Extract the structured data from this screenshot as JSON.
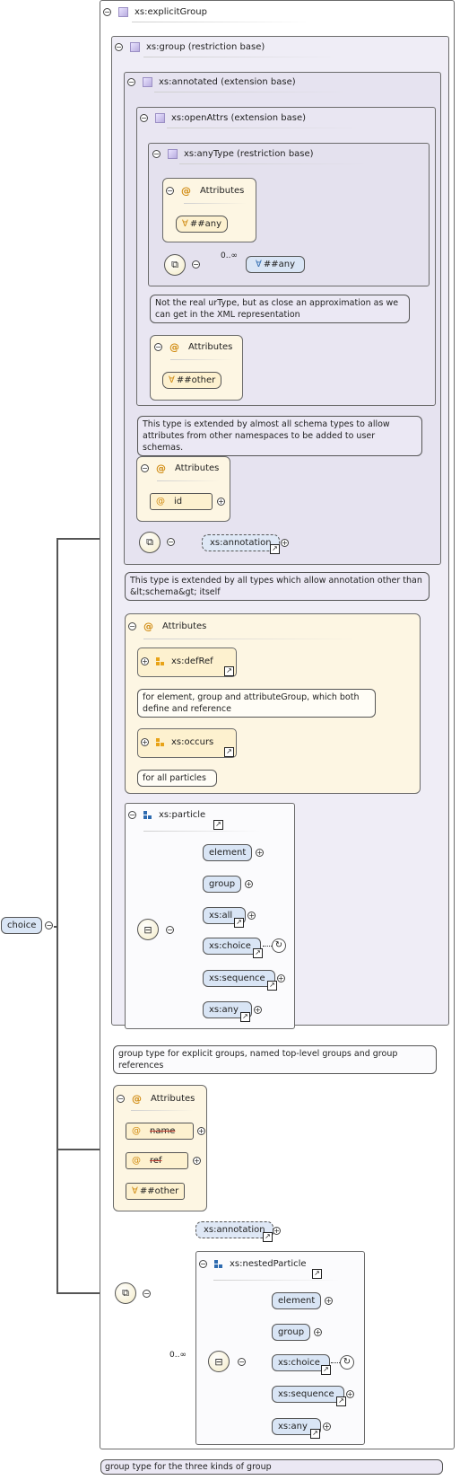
{
  "root": {
    "label": "choice"
  },
  "explicit_group": {
    "title": "xs:explicitGroup",
    "group_restriction": {
      "title": "xs:group (restriction base)",
      "annotated": {
        "title": "xs:annotated (extension base)",
        "open_attrs": {
          "title": "xs:openAttrs (extension base)",
          "any_type": {
            "title": "xs:anyType (restriction base)",
            "attributes_label": "Attributes",
            "any_attr": "##any",
            "any_element": "##any",
            "multiplicity": "0..∞"
          },
          "any_type_note": "Not the real urType, but as close an approximation as we can get in the XML representation",
          "attributes_label": "Attributes",
          "other_attr": "##other"
        },
        "open_attrs_note": "This type is extended by almost all schema types to allow attributes from other namespaces to be added to user schemas.",
        "attributes_label": "Attributes",
        "id_attr": "id",
        "annotation_element": "xs:annotation"
      },
      "annotated_note": "This type is extended by all types which allow annotation other than &lt;schema&gt; itself",
      "attributes": {
        "label": "Attributes",
        "def_ref": "xs:defRef",
        "def_ref_note": "for element, group and attributeGroup, which both define and reference",
        "occurs": "xs:occurs",
        "occurs_note": "for all particles"
      },
      "particle": {
        "title": "xs:particle",
        "items": [
          "element",
          "group",
          "xs:all",
          "xs:choice",
          "xs:sequence",
          "xs:any"
        ]
      }
    },
    "group_note": "group type for explicit groups, named top-level groups and group references",
    "attributes": {
      "label": "Attributes",
      "name": "name",
      "ref": "ref",
      "other": "##other"
    },
    "annotation_element": "xs:annotation",
    "multiplicity": "0..∞",
    "nested_particle": {
      "title": "xs:nestedParticle",
      "items": [
        "element",
        "group",
        "xs:choice",
        "xs:sequence",
        "xs:any"
      ]
    }
  },
  "explicit_group_note": "group type for the three kinds of group"
}
